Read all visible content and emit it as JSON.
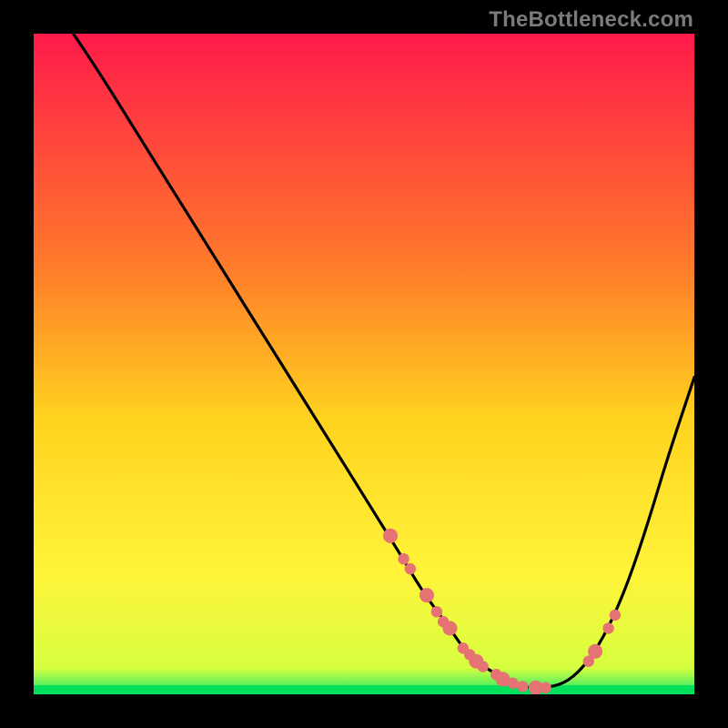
{
  "watermark": "TheBottleneck.com",
  "chart_data": {
    "type": "line",
    "title": "",
    "xlabel": "",
    "ylabel": "",
    "xlim": [
      0,
      100
    ],
    "ylim": [
      0,
      100
    ],
    "grid": false,
    "series": [
      {
        "name": "curve",
        "x": [
          6,
          10,
          15,
          20,
          25,
          30,
          35,
          40,
          45,
          50,
          55,
          58,
          60,
          63,
          65,
          67,
          70,
          73,
          75,
          78,
          81,
          84,
          87,
          90,
          93,
          96,
          100
        ],
        "y": [
          100,
          94,
          86,
          78,
          70,
          62,
          54,
          46,
          38,
          30,
          22,
          17,
          14,
          10,
          7,
          5,
          3,
          1.5,
          1,
          1,
          2,
          5,
          10,
          17,
          26,
          36,
          48
        ]
      }
    ],
    "markers": {
      "name": "highlighted-points",
      "x": [
        54,
        56,
        57,
        59.5,
        61,
        62,
        63,
        65,
        66,
        67,
        68,
        70,
        71,
        72.5,
        74,
        76,
        77.5,
        84,
        85,
        87,
        88
      ],
      "y": [
        24,
        20.5,
        19,
        15,
        12.5,
        11,
        10,
        7,
        6,
        5,
        4.2,
        3,
        2.3,
        1.7,
        1.2,
        1,
        1,
        5,
        6.5,
        10,
        12
      ]
    },
    "colors": {
      "curve": "#000000",
      "markers": "#e57373",
      "gradient_top": "#ff1a4b",
      "gradient_mid1": "#ff7a2a",
      "gradient_mid2": "#ffd21f",
      "gradient_mid3": "#fff43a",
      "gradient_bottom": "#17e86b",
      "bottom_band": "#00e05a"
    }
  }
}
